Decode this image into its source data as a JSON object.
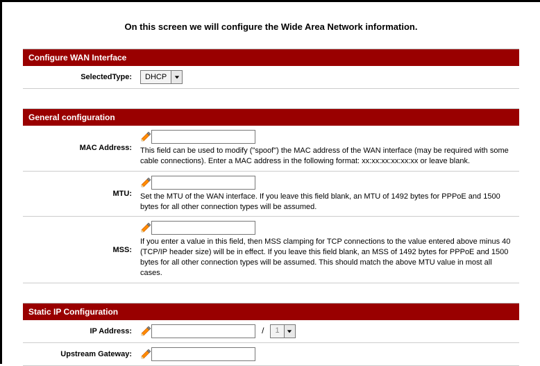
{
  "title": "On this screen we will configure the Wide Area Network information.",
  "sections": {
    "wan": {
      "header": "Configure WAN Interface",
      "selectedType_label": "SelectedType:",
      "selectedType_value": "DHCP"
    },
    "general": {
      "header": "General configuration",
      "mac_label": "MAC Address:",
      "mac_value": "",
      "mac_desc": "This field can be used to modify (\"spoof\") the MAC address of the WAN interface (may be required with some cable connections). Enter a MAC address in the following format: xx:xx:xx:xx:xx:xx or leave blank.",
      "mtu_label": "MTU:",
      "mtu_value": "",
      "mtu_desc": "Set the MTU of the WAN interface. If you leave this field blank, an MTU of 1492 bytes for PPPoE and 1500 bytes for all other connection types will be assumed.",
      "mss_label": "MSS:",
      "mss_value": "",
      "mss_desc": "If you enter a value in this field, then MSS clamping for TCP connections to the value entered above minus 40 (TCP/IP header size) will be in effect. If you leave this field blank, an MSS of 1492 bytes for PPPoE and 1500 bytes for all other connection types will be assumed. This should match the above MTU value in most all cases."
    },
    "static": {
      "header": "Static IP Configuration",
      "ip_label": "IP Address:",
      "ip_value": "",
      "ip_cidr": "1",
      "gw_label": "Upstream Gateway:",
      "gw_value": ""
    }
  }
}
